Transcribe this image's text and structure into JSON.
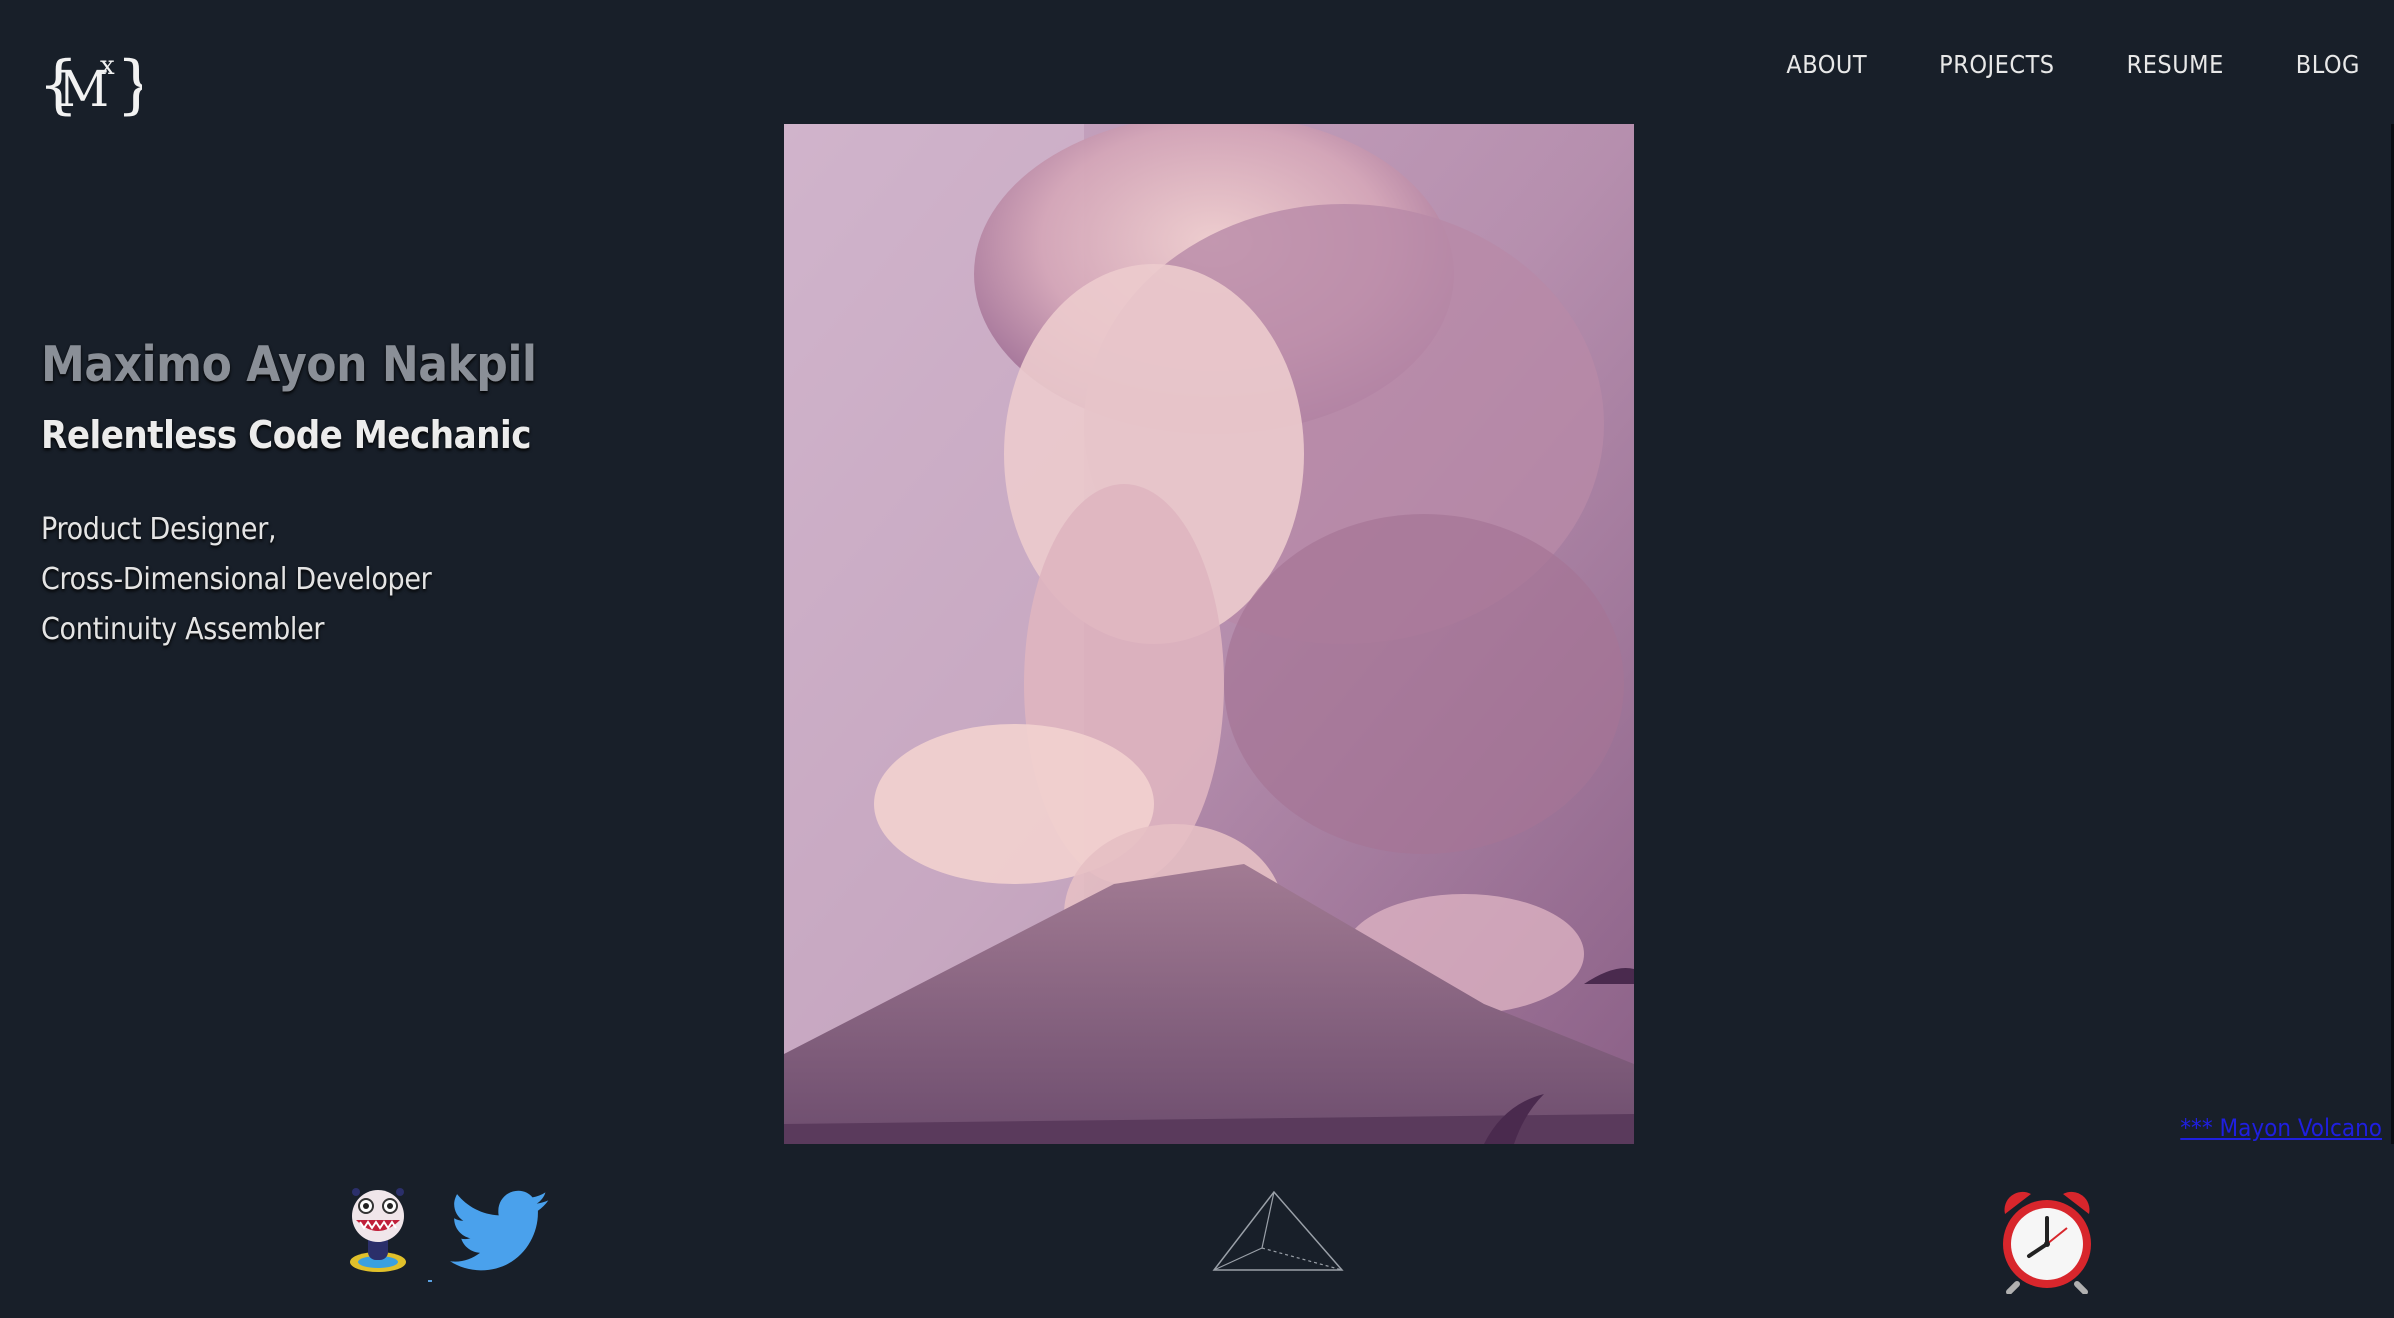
{
  "header": {
    "logo_text": "{M^x}",
    "nav": [
      {
        "label": "ABOUT"
      },
      {
        "label": "PROJECTS"
      },
      {
        "label": "RESUME"
      },
      {
        "label": "BLOG"
      }
    ]
  },
  "intro": {
    "name": "Maximo Ayon Nakpil",
    "tagline": "Relentless Code Mechanic",
    "roles": [
      "Product Designer,",
      "Cross-Dimensional Developer",
      "Continuity Assembler"
    ]
  },
  "hero": {
    "caption": "*** Mayon Volcano"
  },
  "footer_icons": [
    "monster-icon",
    "twitter-icon",
    "pyramid-icon",
    "alarm-clock-icon"
  ],
  "colors": {
    "background": "#181f29",
    "link": "#1f1fe0",
    "twitter": "#4aa1ec"
  }
}
